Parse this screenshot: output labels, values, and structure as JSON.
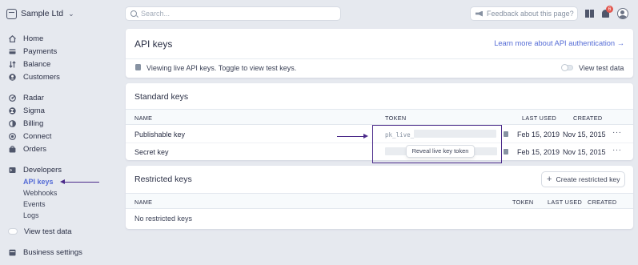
{
  "topbar": {
    "account_name": "Sample Ltd",
    "search_placeholder": "Search...",
    "feedback_label": "Feedback about this page?",
    "notification_count": "6"
  },
  "sidebar": {
    "items": [
      {
        "label": "Home",
        "icon": "home-icon"
      },
      {
        "label": "Payments",
        "icon": "payments-icon"
      },
      {
        "label": "Balance",
        "icon": "balance-icon"
      },
      {
        "label": "Customers",
        "icon": "customers-icon"
      },
      {
        "label": "Radar",
        "icon": "radar-icon"
      },
      {
        "label": "Sigma",
        "icon": "sigma-icon"
      },
      {
        "label": "Billing",
        "icon": "billing-icon"
      },
      {
        "label": "Connect",
        "icon": "connect-icon"
      },
      {
        "label": "Orders",
        "icon": "orders-icon"
      },
      {
        "label": "Developers",
        "icon": "developers-icon"
      }
    ],
    "developer_subitems": [
      "API keys",
      "Webhooks",
      "Events",
      "Logs"
    ],
    "active_subitem": "API keys",
    "view_test_data": "View test data",
    "business_settings": "Business settings"
  },
  "api_keys_panel": {
    "title": "API keys",
    "learn_more": "Learn more about API authentication →",
    "info_text": "Viewing live API keys. Toggle to view test keys.",
    "toggle_label": "View test data"
  },
  "standard_keys": {
    "title": "Standard keys",
    "columns": [
      "NAME",
      "TOKEN",
      "LAST USED",
      "CREATED"
    ],
    "rows": [
      {
        "name": "Publishable key",
        "token": "pk_live_",
        "last_used": "Feb 15, 2019",
        "created": "Nov 15, 2015"
      },
      {
        "name": "Secret key",
        "token": "",
        "last_used": "Feb 15, 2019",
        "created": "Nov 15, 2015"
      }
    ],
    "tooltip": "Reveal live key token",
    "more": "···"
  },
  "restricted_keys": {
    "title": "Restricted keys",
    "create_button": "Create restricted key",
    "columns": [
      "NAME",
      "TOKEN",
      "LAST USED",
      "CREATED"
    ],
    "empty_text": "No restricted keys"
  },
  "colors": {
    "accent": "#556cd6",
    "annotation": "#4b2a8a",
    "background": "#e6e9ef"
  }
}
